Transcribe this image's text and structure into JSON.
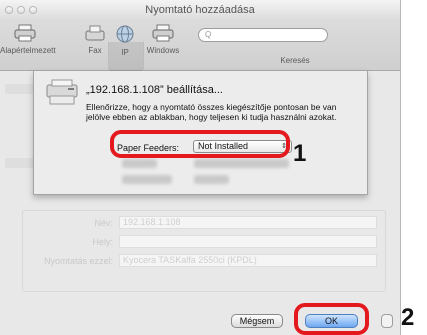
{
  "window": {
    "title": "Nyomtató hozzáadása"
  },
  "toolbar": {
    "items": [
      {
        "label": "Alapértelmezett",
        "icon": "default-printer-icon"
      },
      {
        "label": "Fax",
        "icon": "fax-icon"
      },
      {
        "label": "IP",
        "icon": "ip-globe-icon"
      },
      {
        "label": "Windows",
        "icon": "windows-printer-icon"
      }
    ],
    "search_placeholder": "Q",
    "search_label": "Keresés"
  },
  "background": {
    "name_label": "Név:",
    "name_value": "192.168.1.108",
    "location_label": "Hely:",
    "use_label": "Nyomtatás ezzel:",
    "use_value": "Kyocera TASKalfa 2550ci (KPDL)"
  },
  "sheet": {
    "title": "„192.168.1.108” beállítása...",
    "description": "Ellenőrizze, hogy a nyomtató összes kiegészítője pontosan be van jelölve ebben az ablakban, hogy teljesen ki tudja használni azokat.",
    "paper_feeders_label": "Paper Feeders:",
    "paper_feeders_value": "Not Installed"
  },
  "buttons": {
    "cancel": "Mégsem",
    "ok": "OK"
  },
  "callouts": {
    "one": "1",
    "two": "2"
  },
  "colors": {
    "callout": "#e3191e"
  }
}
